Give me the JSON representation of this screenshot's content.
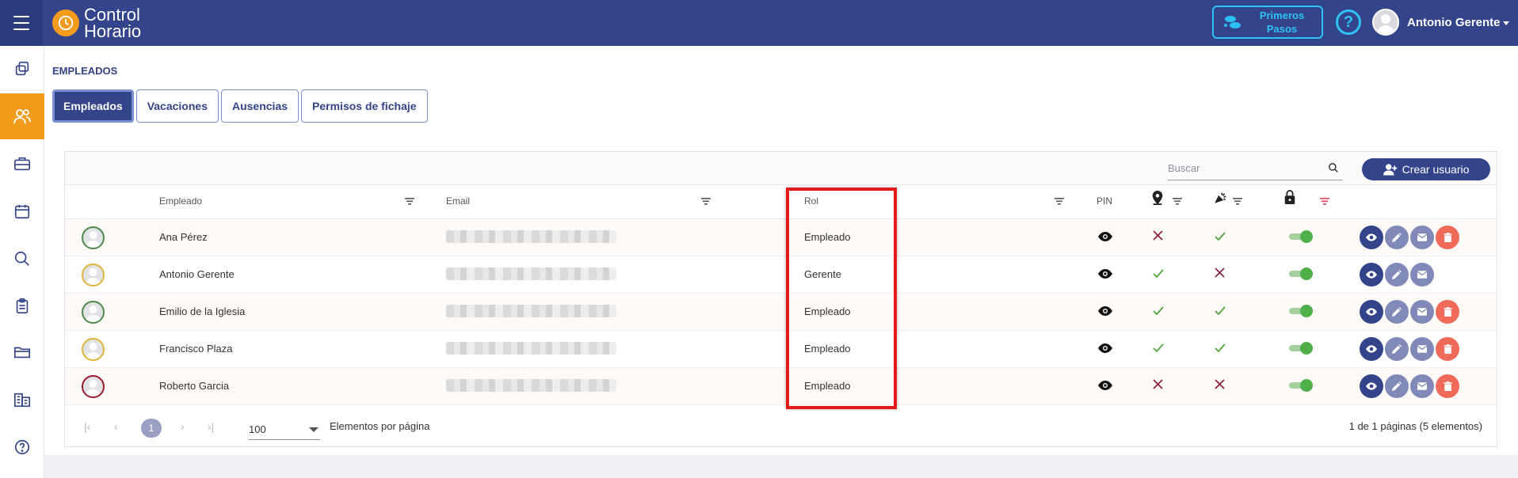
{
  "app": {
    "logo_line1": "Control",
    "logo_line2": "Horario",
    "first_steps_label": "Primeros Pasos",
    "help_symbol": "?",
    "user_name": "Antonio Gerente"
  },
  "sidebar": {
    "items": [
      {
        "icon": "copy-icon"
      },
      {
        "icon": "users-icon",
        "active": true
      },
      {
        "icon": "briefcase-icon"
      },
      {
        "icon": "calendar-icon"
      },
      {
        "icon": "search-icon"
      },
      {
        "icon": "clipboard-icon"
      },
      {
        "icon": "folder-icon"
      },
      {
        "icon": "buildings-icon"
      },
      {
        "icon": "help-icon"
      }
    ]
  },
  "page": {
    "title": "EMPLEADOS",
    "tabs": [
      {
        "label": "Empleados",
        "active": true
      },
      {
        "label": "Vacaciones"
      },
      {
        "label": "Ausencias"
      },
      {
        "label": "Permisos de fichaje"
      }
    ]
  },
  "table": {
    "search_placeholder": "Buscar",
    "create_label": "Crear usuario",
    "headers": {
      "employee": "Empleado",
      "email": "Email",
      "role": "Rol",
      "pin": "PIN"
    },
    "rows": [
      {
        "name": "Ana Pérez",
        "role": "Empleado",
        "ring": "#4c8a4c",
        "geo": false,
        "clock": true,
        "active": true,
        "deletable": true
      },
      {
        "name": "Antonio Gerente",
        "role": "Gerente",
        "ring": "#e0b43a",
        "geo": true,
        "clock": false,
        "active": true,
        "deletable": false
      },
      {
        "name": "Emilio de la Iglesia",
        "role": "Empleado",
        "ring": "#4c8a4c",
        "geo": true,
        "clock": true,
        "active": true,
        "deletable": true
      },
      {
        "name": "Francisco Plaza",
        "role": "Empleado",
        "ring": "#e0b43a",
        "geo": true,
        "clock": true,
        "active": true,
        "deletable": true
      },
      {
        "name": "Roberto Garcia",
        "role": "Empleado",
        "ring": "#9b1c2e",
        "geo": false,
        "clock": false,
        "active": true,
        "deletable": true
      }
    ],
    "pagination": {
      "current_page": "1",
      "per_page": "100",
      "per_page_label": "Elementos por página",
      "info": "1 de 1 páginas (5 elementos)"
    }
  },
  "colors": {
    "primary": "#33448a",
    "accent": "#f39b1d",
    "info": "#2ec1f5",
    "success": "#4fb04a",
    "danger": "#f06a5a",
    "highlight": "#e51a1a"
  }
}
